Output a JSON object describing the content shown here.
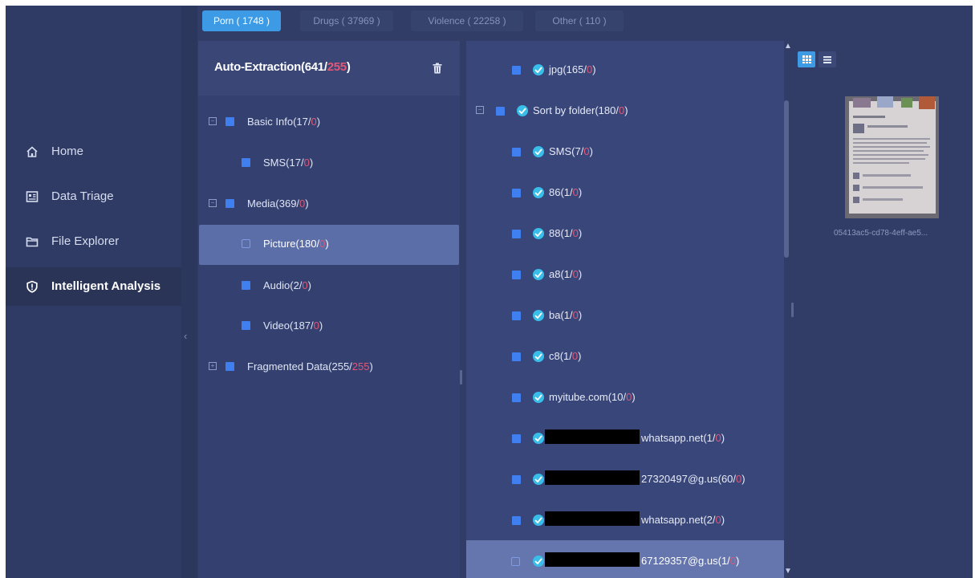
{
  "sidebar": {
    "items": [
      {
        "label": "Home",
        "icon": "home-icon"
      },
      {
        "label": "Data Triage",
        "icon": "data-triage-icon"
      },
      {
        "label": "File Explorer",
        "icon": "folder-icon"
      },
      {
        "label": "Intelligent Analysis",
        "icon": "shield-alert-icon",
        "active": true
      }
    ]
  },
  "tabs": [
    {
      "label": "Porn ( 1748 )",
      "active": true
    },
    {
      "label": "Drugs ( 37969 )"
    },
    {
      "label": "Violence ( 22258 )"
    },
    {
      "label": "Other ( 110 )"
    }
  ],
  "tree": {
    "title": "Auto-Extraction(641/",
    "title_flag": "255",
    "title_end": ")",
    "rows": [
      {
        "label": "Basic Info(17/",
        "flag": "0",
        "end": ")"
      },
      {
        "label": "SMS(17/",
        "flag": "0",
        "end": ")"
      },
      {
        "label": "Media(369/",
        "flag": "0",
        "end": ")"
      },
      {
        "label": "Picture(180/",
        "flag": "0",
        "end": ")"
      },
      {
        "label": "Audio(2/",
        "flag": "0",
        "end": ")"
      },
      {
        "label": "Video(187/",
        "flag": "0",
        "end": ")"
      },
      {
        "label": "Fragmented Data(255/",
        "flag": "255",
        "end": ")"
      }
    ]
  },
  "files": {
    "rows": [
      {
        "label": "jpg(165/",
        "flag": "0",
        "end": ")"
      },
      {
        "label": "Sort by folder(180/",
        "flag": "0",
        "end": ")"
      },
      {
        "label": "SMS(7/",
        "flag": "0",
        "end": ")"
      },
      {
        "label": "86(1/",
        "flag": "0",
        "end": ")"
      },
      {
        "label": "88(1/",
        "flag": "0",
        "end": ")"
      },
      {
        "label": "a8(1/",
        "flag": "0",
        "end": ")"
      },
      {
        "label": "ba(1/",
        "flag": "0",
        "end": ")"
      },
      {
        "label": "c8(1/",
        "flag": "0",
        "end": ")"
      },
      {
        "label": "myitube.com(10/",
        "flag": "0",
        "end": ")"
      },
      {
        "label": "whatsapp.net(1/",
        "flag": "0",
        "end": ")"
      },
      {
        "label": "27320497@g.us(60/",
        "flag": "0",
        "end": ")"
      },
      {
        "label": "whatsapp.net(2/",
        "flag": "0",
        "end": ")"
      },
      {
        "label": "67129357@g.us(1/",
        "flag": "0",
        "end": ")"
      }
    ]
  },
  "preview": {
    "caption": "05413ac5-cd78-4eff-ae5..."
  },
  "colors": {
    "accent": "#3d9be6",
    "flag": "#e05777",
    "check": "#39bde9",
    "checkbox": "#3f7ff0"
  }
}
